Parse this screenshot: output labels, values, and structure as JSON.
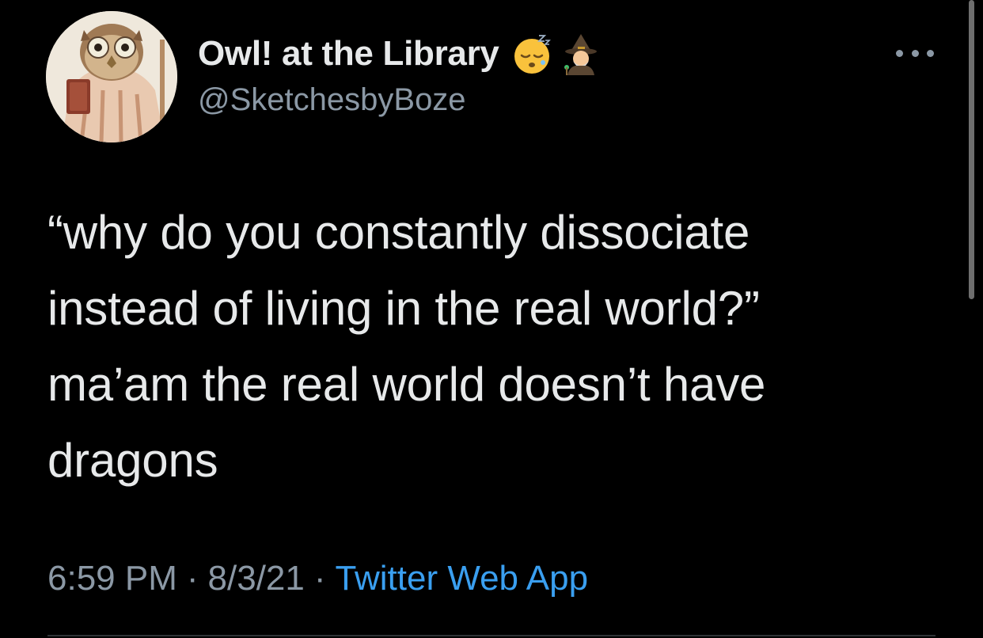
{
  "tweet": {
    "author": {
      "display_name": "Owl! at the Library",
      "handle": "@SketchesbyBoze",
      "name_emojis": [
        "sleeping-face-emoji",
        "mage-emoji"
      ]
    },
    "text": "“why do you constantly dissociate\ninstead of living in the real world?”\nma’am the real world doesn’t have\ndragons",
    "meta": {
      "time": "6:59 PM",
      "separator": "·",
      "date": "8/3/21",
      "source": "Twitter Web App"
    },
    "more_menu_icon": "more-horizontal-icon"
  },
  "colors": {
    "background": "#000000",
    "primary_text": "#e7e9ea",
    "secondary_text": "#8b98a5",
    "link": "#3a9ff0"
  }
}
